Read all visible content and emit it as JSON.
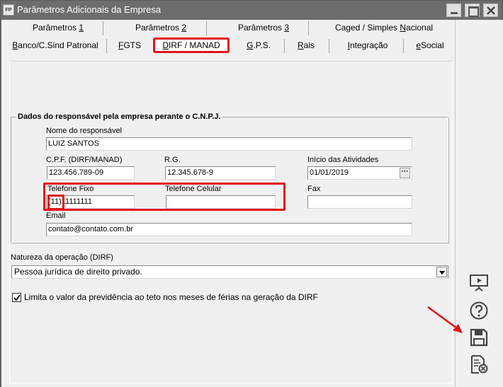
{
  "window": {
    "app_icon_text": "FP",
    "title": "Parâmetros Adicionais da Empresa"
  },
  "tabs_row1": [
    {
      "label": "Parâmetros ",
      "mnemonic": "1"
    },
    {
      "label": "Parâmetros ",
      "mnemonic": "2"
    },
    {
      "label": "Parâmetros ",
      "mnemonic": "3"
    },
    {
      "label": "Caged / Simples ",
      "mnemonic": "N",
      "suffix": "acional"
    }
  ],
  "tabs_row2": [
    {
      "pre": "",
      "mnemonic": "B",
      "label": "anco/C.Sind Patronal"
    },
    {
      "pre": "",
      "mnemonic": "F",
      "label": "GTS"
    },
    {
      "pre": "",
      "mnemonic": "D",
      "label": "IRF / MANAD"
    },
    {
      "pre": "",
      "mnemonic": "G",
      "label": ".P.S."
    },
    {
      "pre": "",
      "mnemonic": "R",
      "label": "ais"
    },
    {
      "pre": "",
      "mnemonic": "I",
      "label": "ntegração"
    },
    {
      "pre": "",
      "mnemonic": "e",
      "label": "Social"
    }
  ],
  "group": {
    "title": "Dados do responsável pela empresa perante o C.N.P.J."
  },
  "fields": {
    "nome_label": "Nome do responsável",
    "nome_value": "LUIZ SANTOS",
    "cpf_label": "C.P.F. (DIRF/MANAD)",
    "cpf_value": "123.456.789-09",
    "rg_label": "R.G.",
    "rg_value": "12.345.678-9",
    "inicio_label": "Início das Atividades",
    "inicio_value": "01/01/2019",
    "inicio_button": "···",
    "tel_fixo_label": "Telefone Fixo",
    "tel_fixo_ddd": "(11)",
    "tel_fixo_number": "11111111",
    "tel_cel_label": "Telefone Celular",
    "tel_cel_value": "",
    "fax_label": "Fax",
    "fax_value": "",
    "email_label": "Email",
    "email_value": "contato@contato.com.br"
  },
  "natureza": {
    "label": "Natureza da operação (DIRF)",
    "selected": "Pessoa jurídica de direito privado."
  },
  "checkbox": {
    "checked": true,
    "label": "Limita o valor da previdência ao teto nos meses de férias na geração da DIRF"
  },
  "colors": {
    "highlight": "#e0151b",
    "titlebar": "#6d6d6d",
    "panel": "#f0f0f0"
  },
  "side_icons": [
    "presentation-icon",
    "help-icon",
    "save-icon",
    "cancel-document-icon"
  ]
}
